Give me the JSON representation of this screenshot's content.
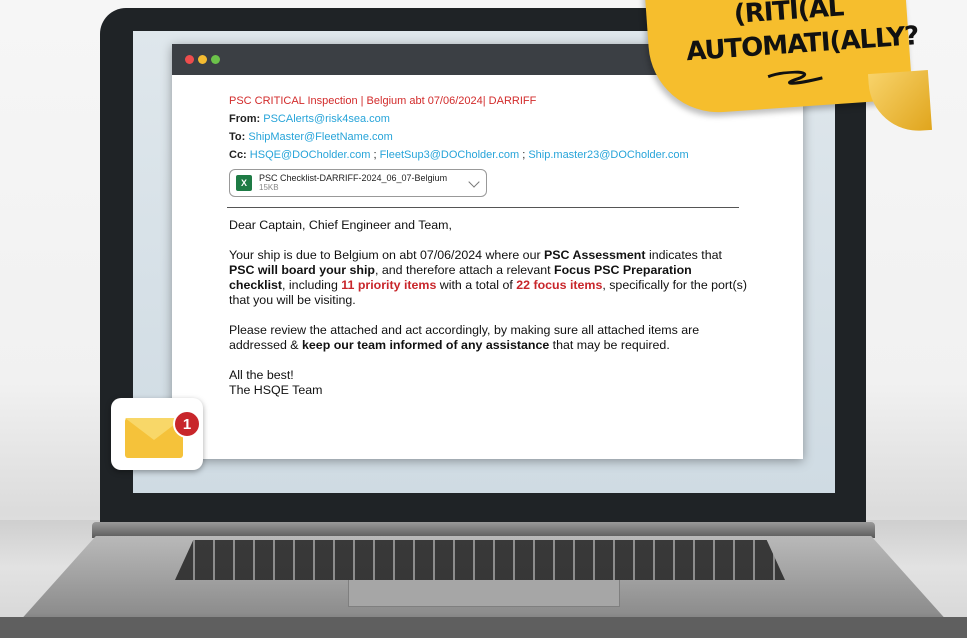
{
  "sticky_note": {
    "line1": "(RITI(AL",
    "line2": "AUTOMATI(ALLY?"
  },
  "email": {
    "subject": "PSC CRITICAL Inspection | Belgium abt 07/06/2024| DARRIFF",
    "from_label": "From:",
    "from": "PSCAlerts@risk4sea.com",
    "to_label": "To:",
    "to": "ShipMaster@FleetName.com",
    "cc_label": "Cc:",
    "cc": [
      "HSQE@DOCholder.com",
      "FleetSup3@DOCholder.com",
      "Ship.master23@DOCholder.com"
    ],
    "cc_sep": ";",
    "attachment": {
      "name": "PSC Checklist-DARRIFF-2024_06_07-Belgium",
      "size": "15KB",
      "icon": "excel-icon"
    },
    "greeting": "Dear Captain, Chief Engineer and Team,",
    "p1_a": "Your ship is due to Belgium on abt 07/06/2024 where our ",
    "p1_b": "PSC Assessment",
    "p1_c": " indicates that ",
    "p1_d": "PSC will board your ship",
    "p1_e": ", and therefore attach a relevant ",
    "p1_f": "Focus PSC Preparation checklist",
    "p1_g": ", including ",
    "p1_h": "11 priority items",
    "p1_i": " with a total of ",
    "p1_j": "22 focus items",
    "p1_k": ", specifically for the port(s) that you will be visiting.",
    "p2_a": "Please review the attached and act accordingly, by making sure all attached items are addressed & ",
    "p2_b": "keep our team informed of any assistance",
    "p2_c": " that may be required.",
    "signoff1": "All the best!",
    "signoff2": "The HSQE Team"
  },
  "notification": {
    "count": "1",
    "icon": "mail-icon"
  },
  "colors": {
    "accent_red": "#c8262b",
    "link_blue": "#27a4d9",
    "sticky": "#f6be2d"
  }
}
